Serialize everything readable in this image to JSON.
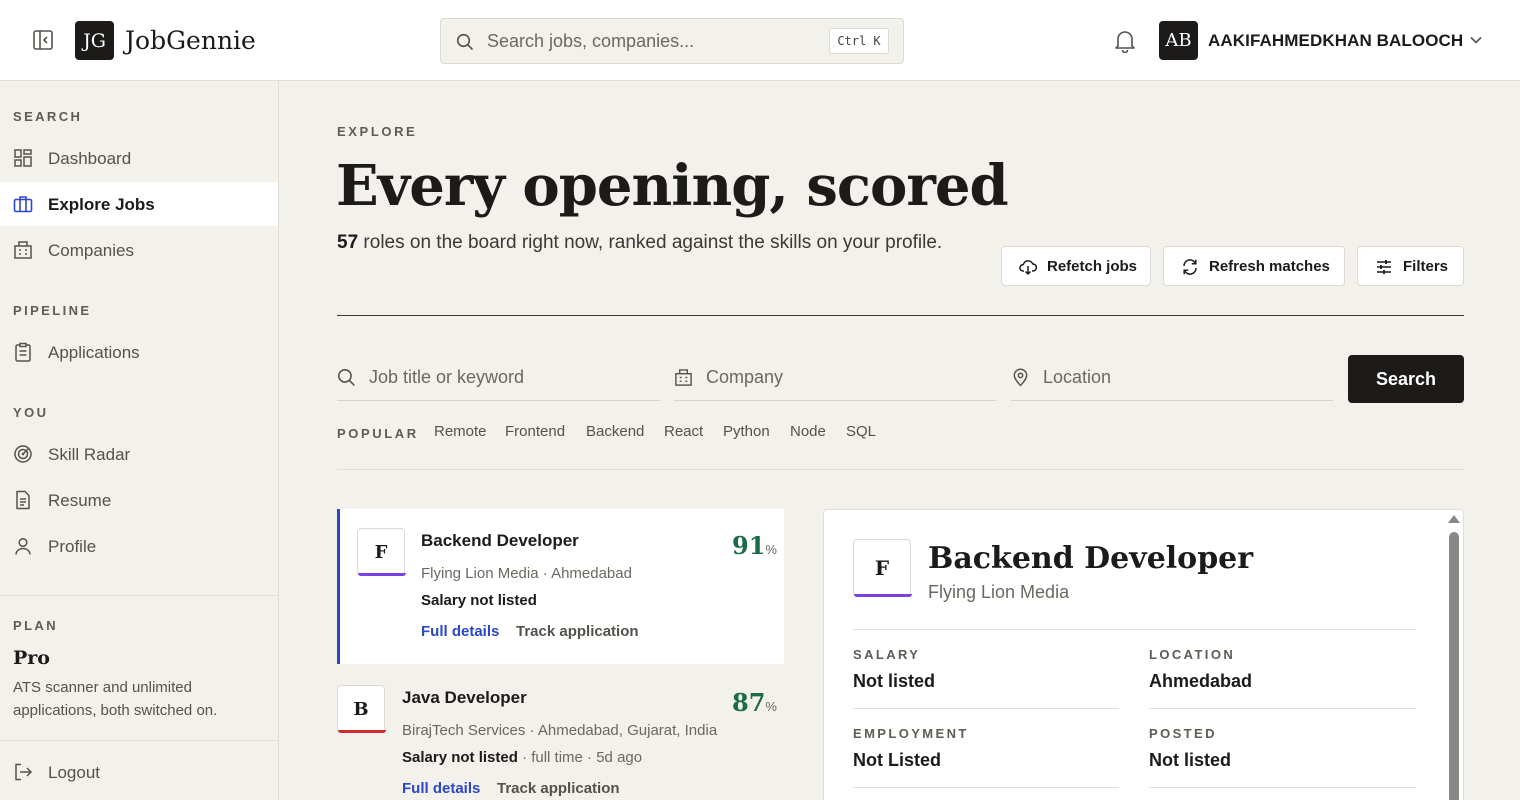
{
  "brand": {
    "mark": "JG",
    "name": "JobGennie"
  },
  "search": {
    "placeholder": "Search jobs, companies...",
    "shortcut": "Ctrl K"
  },
  "user": {
    "initials": "AB",
    "name": "AAKIFAHMEDKHAN BALOOCH"
  },
  "sidebar": {
    "sections": [
      {
        "label": "SEARCH"
      },
      {
        "label": "PIPELINE"
      },
      {
        "label": "YOU"
      },
      {
        "label": "PLAN"
      }
    ],
    "items": [
      {
        "label": "Dashboard",
        "icon": "grid-icon"
      },
      {
        "label": "Explore Jobs",
        "icon": "briefcase-icon",
        "active": true
      },
      {
        "label": "Companies",
        "icon": "building-icon"
      },
      {
        "label": "Applications",
        "icon": "clipboard-icon"
      },
      {
        "label": "Skill Radar",
        "icon": "radar-icon"
      },
      {
        "label": "Resume",
        "icon": "document-icon"
      },
      {
        "label": "Profile",
        "icon": "user-icon"
      }
    ],
    "plan": {
      "name": "Pro",
      "description": "ATS scanner and unlimited applications, both switched on."
    },
    "logout": "Logout"
  },
  "main": {
    "eyebrow": "EXPLORE",
    "headline": "Every opening, scored",
    "subhead_count": "57",
    "subhead_text": " roles on the board right now, ranked against the skills on your profile.",
    "buttons": {
      "refetch": "Refetch jobs",
      "refresh": "Refresh matches",
      "filters": "Filters"
    },
    "fields": {
      "keyword": "Job title or keyword",
      "company": "Company",
      "location": "Location"
    },
    "search_button": "Search",
    "popular_label": "POPULAR",
    "popular_tags": [
      "Remote",
      "Frontend",
      "Backend",
      "React",
      "Python",
      "Node",
      "SQL"
    ]
  },
  "jobs": [
    {
      "logo": "F",
      "logo_color": "#7b3fe4",
      "title": "Backend Developer",
      "meta": "Flying Lion Media · Ahmedabad",
      "salary": "Salary not listed",
      "salary_extra": "",
      "score": "91",
      "score_unit": "%",
      "link_details": "Full details",
      "link_track": "Track application"
    },
    {
      "logo": "B",
      "logo_color": "#d12a2a",
      "title": "Java Developer",
      "meta": "BirajTech Services · Ahmedabad, Gujarat, India",
      "salary": "Salary not listed",
      "salary_extra": " · full time · 5d ago",
      "score": "87",
      "score_unit": "%",
      "link_details": "Full details",
      "link_track": "Track application"
    }
  ],
  "detail": {
    "logo": "F",
    "logo_color": "#7b3fe4",
    "title": "Backend Developer",
    "company": "Flying Lion Media",
    "fields": [
      {
        "label": "SALARY",
        "value": "Not listed"
      },
      {
        "label": "LOCATION",
        "value": "Ahmedabad"
      },
      {
        "label": "EMPLOYMENT",
        "value": "Not Listed"
      },
      {
        "label": "POSTED",
        "value": "Not listed"
      }
    ]
  },
  "colors": {
    "accent": "#2c47c6",
    "score": "#1a6b47",
    "ink": "#1c1b19",
    "background": "#f3f1ec"
  }
}
